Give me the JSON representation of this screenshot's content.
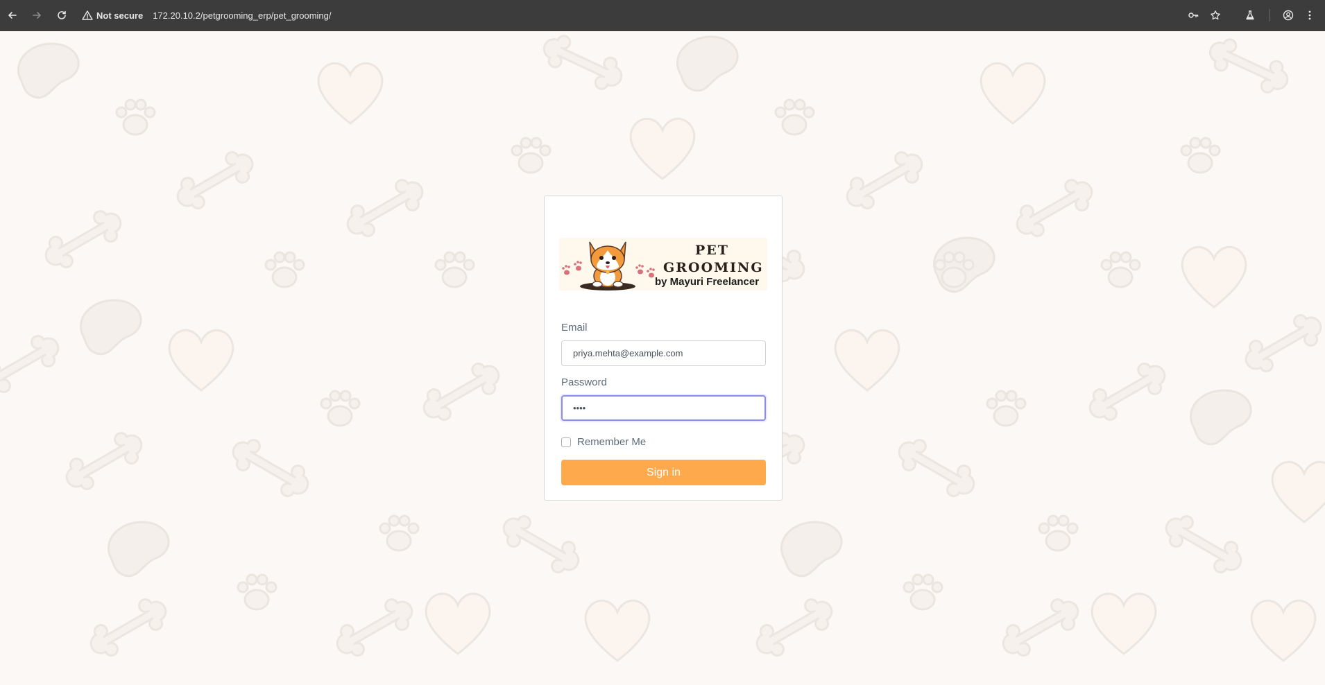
{
  "browser": {
    "security_label": "Not secure",
    "url": "172.20.10.2/petgrooming_erp/pet_grooming/"
  },
  "logo": {
    "line1": "PET",
    "line2": "GROOMING",
    "line3": "by Mayuri Freelancer"
  },
  "login_form": {
    "email_label": "Email",
    "email_value": "priya.mehta@example.com",
    "password_label": "Password",
    "password_value": "••••",
    "remember_label": "Remember Me",
    "remember_checked": false,
    "submit_label": "Sign in"
  },
  "colors": {
    "chrome_bg": "#3c3c3c",
    "page_bg": "#fbf8f6",
    "accent_button": "#ffa94d",
    "focus_border": "#8c8ee8"
  },
  "icons": [
    "back-icon",
    "forward-icon",
    "reload-icon",
    "warning-icon",
    "password-key-icon",
    "bookmark-star-icon",
    "labs-flask-icon",
    "profile-icon",
    "menu-icon",
    "corgi-logo-icon",
    "paw-icon"
  ]
}
